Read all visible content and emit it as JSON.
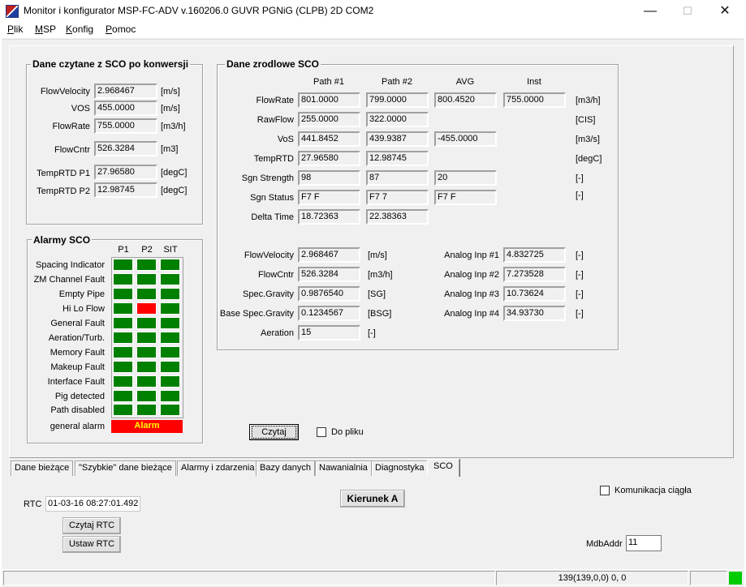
{
  "window": {
    "title": "Monitor i konfigurator MSP-FC-ADV v.160206.0 GUVR PGNiG (CLPB) 2D COM2",
    "minimize": "—",
    "maximize": "☐",
    "close": "✕"
  },
  "menu": [
    {
      "acc": "P",
      "rest": "lik"
    },
    {
      "acc": "M",
      "rest": "SP"
    },
    {
      "acc": "K",
      "rest": "onfig"
    },
    {
      "acc": "P",
      "rest": "omoc"
    }
  ],
  "converted": {
    "title": "Dane czytane z SCO po konwersji",
    "rows": [
      {
        "label": "FlowVelocity",
        "value": "2.968467",
        "unit": "[m/s]"
      },
      {
        "label": "VOS",
        "value": "455.0000",
        "unit": "[m/s]"
      },
      {
        "label": "FlowRate",
        "value": "755.0000",
        "unit": "[m3/h]"
      },
      {
        "label": "FlowCntr",
        "value": "526.3284",
        "unit": "[m3]"
      },
      {
        "label": "TempRTD P1",
        "value": "27.96580",
        "unit": "[degC]"
      },
      {
        "label": "TempRTD P2",
        "value": "12.98745",
        "unit": "[degC]"
      }
    ]
  },
  "alarms": {
    "title": "Alarmy SCO",
    "columns": [
      "P1",
      "P2",
      "SIT"
    ],
    "rows": [
      {
        "label": "Spacing Indicator",
        "p2_on": false
      },
      {
        "label": "ZM Channel Fault",
        "p2_on": false
      },
      {
        "label": "Empty Pipe",
        "p2_on": false
      },
      {
        "label": "Hi Lo Flow",
        "p2_on": true
      },
      {
        "label": "General Fault",
        "p2_on": false
      },
      {
        "label": "Aeration/Turb.",
        "p2_on": false
      },
      {
        "label": "Memory Fault",
        "p2_on": false
      },
      {
        "label": "Makeup Fault",
        "p2_on": false
      },
      {
        "label": "Interface Fault",
        "p2_on": false
      },
      {
        "label": "Pig detected",
        "p2_on": false
      },
      {
        "label": "Path disabled",
        "p2_on": false
      }
    ],
    "general_label": "general alarm",
    "general_value": "Alarm"
  },
  "source": {
    "title": "Dane zrodlowe SCO",
    "columns": [
      "Path #1",
      "Path #2",
      "AVG",
      "Inst"
    ],
    "rows": [
      {
        "label": "FlowRate",
        "values": [
          "801.0000",
          "799.0000",
          "800.4520",
          "755.0000"
        ],
        "unit": "[m3/h]"
      },
      {
        "label": "RawFlow",
        "values": [
          "255.0000",
          "322.0000"
        ],
        "unit": "[CIS]"
      },
      {
        "label": "VoS",
        "values": [
          "441.8452",
          "439.9387",
          "-455.0000"
        ],
        "unit": "[m3/s]"
      },
      {
        "label": "TempRTD",
        "values": [
          "27.96580",
          "12.98745"
        ],
        "unit": "[degC]"
      },
      {
        "label": "Sgn Strength",
        "values": [
          "98",
          "87",
          "20"
        ],
        "unit": "[-]"
      },
      {
        "label": "Sgn Status",
        "values": [
          "F7 F",
          "F7 7",
          "F7 F"
        ],
        "unit": "[-]"
      },
      {
        "label": "Delta Time",
        "values": [
          "18.72363",
          "22.38363"
        ],
        "unit": ""
      }
    ],
    "lower_left": [
      {
        "label": "FlowVelocity",
        "value": "2.968467",
        "unit": "[m/s]"
      },
      {
        "label": "FlowCntr",
        "value": "526.3284",
        "unit": "[m3/h]"
      },
      {
        "label": "Spec.Gravity",
        "value": "0.9876540",
        "unit": "[SG]"
      },
      {
        "label": "Base Spec.Gravity",
        "value": "0.1234567",
        "unit": "[BSG]"
      },
      {
        "label": "Aeration",
        "value": "15",
        "unit": "[-]"
      }
    ],
    "analog": [
      {
        "label": "Analog Inp #1",
        "value": "4.832725",
        "unit": "[-]"
      },
      {
        "label": "Analog Inp #2",
        "value": "7.273528",
        "unit": "[-]"
      },
      {
        "label": "Analog Inp #3",
        "value": "10.73624",
        "unit": "[-]"
      },
      {
        "label": "Analog Inp #4",
        "value": "34.93730",
        "unit": "[-]"
      }
    ]
  },
  "actions": {
    "read": "Czytaj",
    "to_file": "Do pliku"
  },
  "tabs": [
    "Dane bieżące",
    "\"Szybkie\" dane bieżące",
    "Alarmy i zdarzenia",
    "Bazy danych",
    "Nawanialnia",
    "Diagnostyka",
    "SCO"
  ],
  "footer": {
    "rtc_label": "RTC",
    "rtc_value": "01-03-16 08:27:01.492",
    "read_rtc": "Czytaj RTC",
    "set_rtc": "Ustaw RTC",
    "direction": "Kierunek A",
    "continuous": "Komunikacja ciągła",
    "mdb_label": "MdbAddr",
    "mdb_value": "11"
  },
  "status": {
    "counter": "139(139,0,0) 0, 0",
    "indicator_color": "#00cc00"
  }
}
